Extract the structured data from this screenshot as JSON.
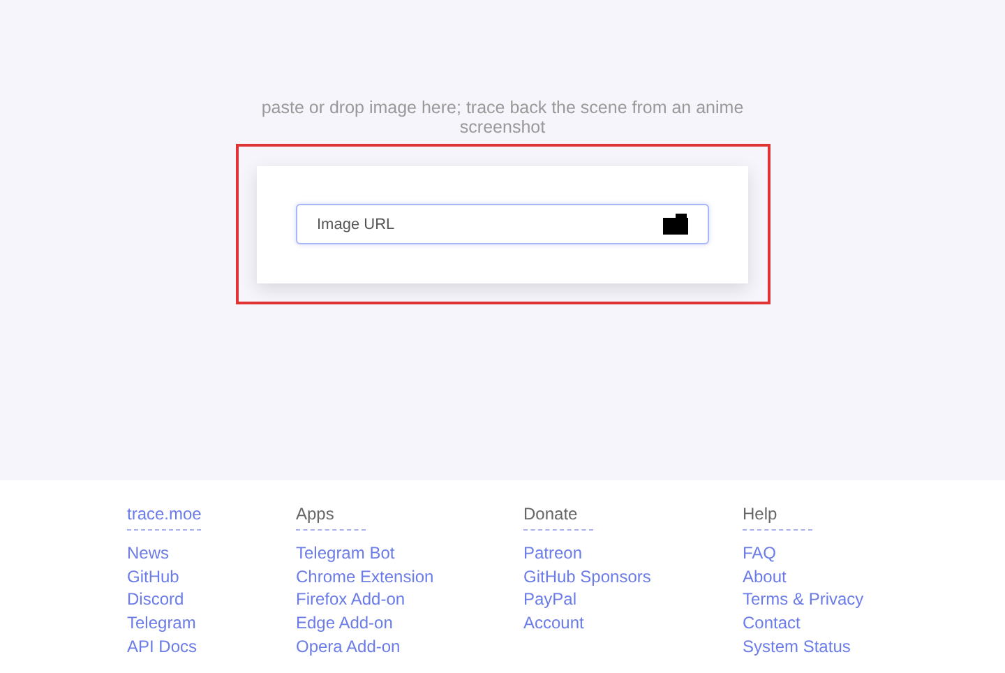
{
  "hero": {
    "caption": "paste or drop image here; trace back the scene from an anime screenshot",
    "highlighted": true,
    "url_field": {
      "placeholder": "Image URL"
    }
  },
  "footer": {
    "columns": [
      {
        "heading": "trace.moe",
        "kind": "link",
        "links": [
          "News",
          "GitHub",
          "Discord",
          "Telegram",
          "API Docs"
        ]
      },
      {
        "heading": "Apps",
        "kind": "plain",
        "links": [
          "Telegram Bot",
          "Chrome Extension",
          "Firefox Add-on",
          "Edge Add-on",
          "Opera Add-on"
        ]
      },
      {
        "heading": "Donate",
        "kind": "plain",
        "links": [
          "Patreon",
          "GitHub Sponsors",
          "PayPal",
          "Account"
        ]
      },
      {
        "heading": "Help",
        "kind": "plain",
        "links": [
          "FAQ",
          "About",
          "Terms & Privacy",
          "Contact",
          "System Status"
        ]
      }
    ]
  }
}
